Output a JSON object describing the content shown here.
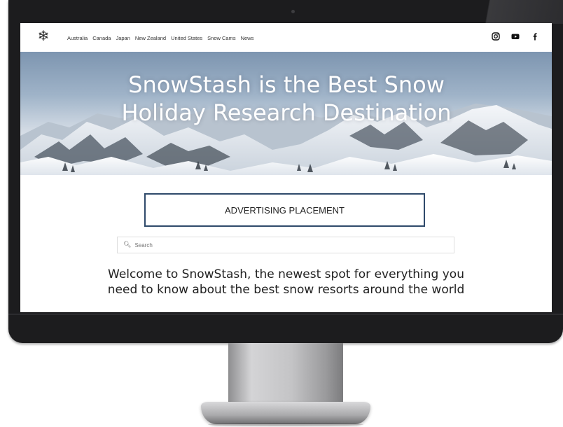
{
  "site": {
    "logo_icon": "snowflake-icon",
    "nav": [
      "Australia",
      "Canada",
      "Japan",
      "New Zealand",
      "United States",
      "Snow Cams",
      "News"
    ],
    "social": [
      "instagram-icon",
      "youtube-icon",
      "facebook-icon"
    ]
  },
  "hero": {
    "title": "SnowStash is the Best Snow Holiday Research Destination"
  },
  "ad": {
    "label": "ADVERTISING PLACEMENT"
  },
  "search": {
    "placeholder": "Search",
    "icon": "search-icon"
  },
  "welcome": {
    "text": "Welcome to SnowStash, the newest spot for everything you need to know about the best snow resorts around the world"
  },
  "colors": {
    "monitor_frame": "#1c1c1e",
    "ad_border": "#2f4a6b",
    "hero_sky": "#9fb3c8"
  }
}
